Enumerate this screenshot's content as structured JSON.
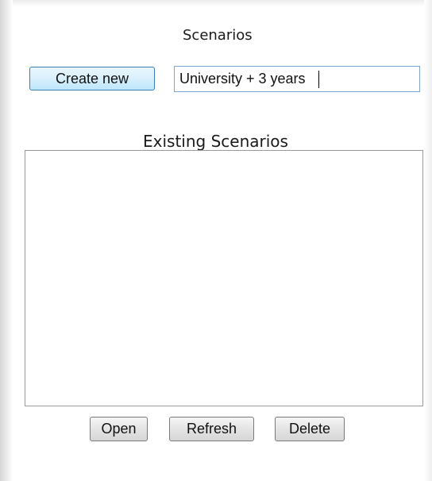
{
  "panel": {
    "title": "Scenarios"
  },
  "create": {
    "button_label": "Create new",
    "name_value": "University + 3 years"
  },
  "existing": {
    "label": "Existing Scenarios",
    "items": []
  },
  "actions": {
    "open_label": "Open",
    "refresh_label": "Refresh",
    "delete_label": "Delete"
  }
}
